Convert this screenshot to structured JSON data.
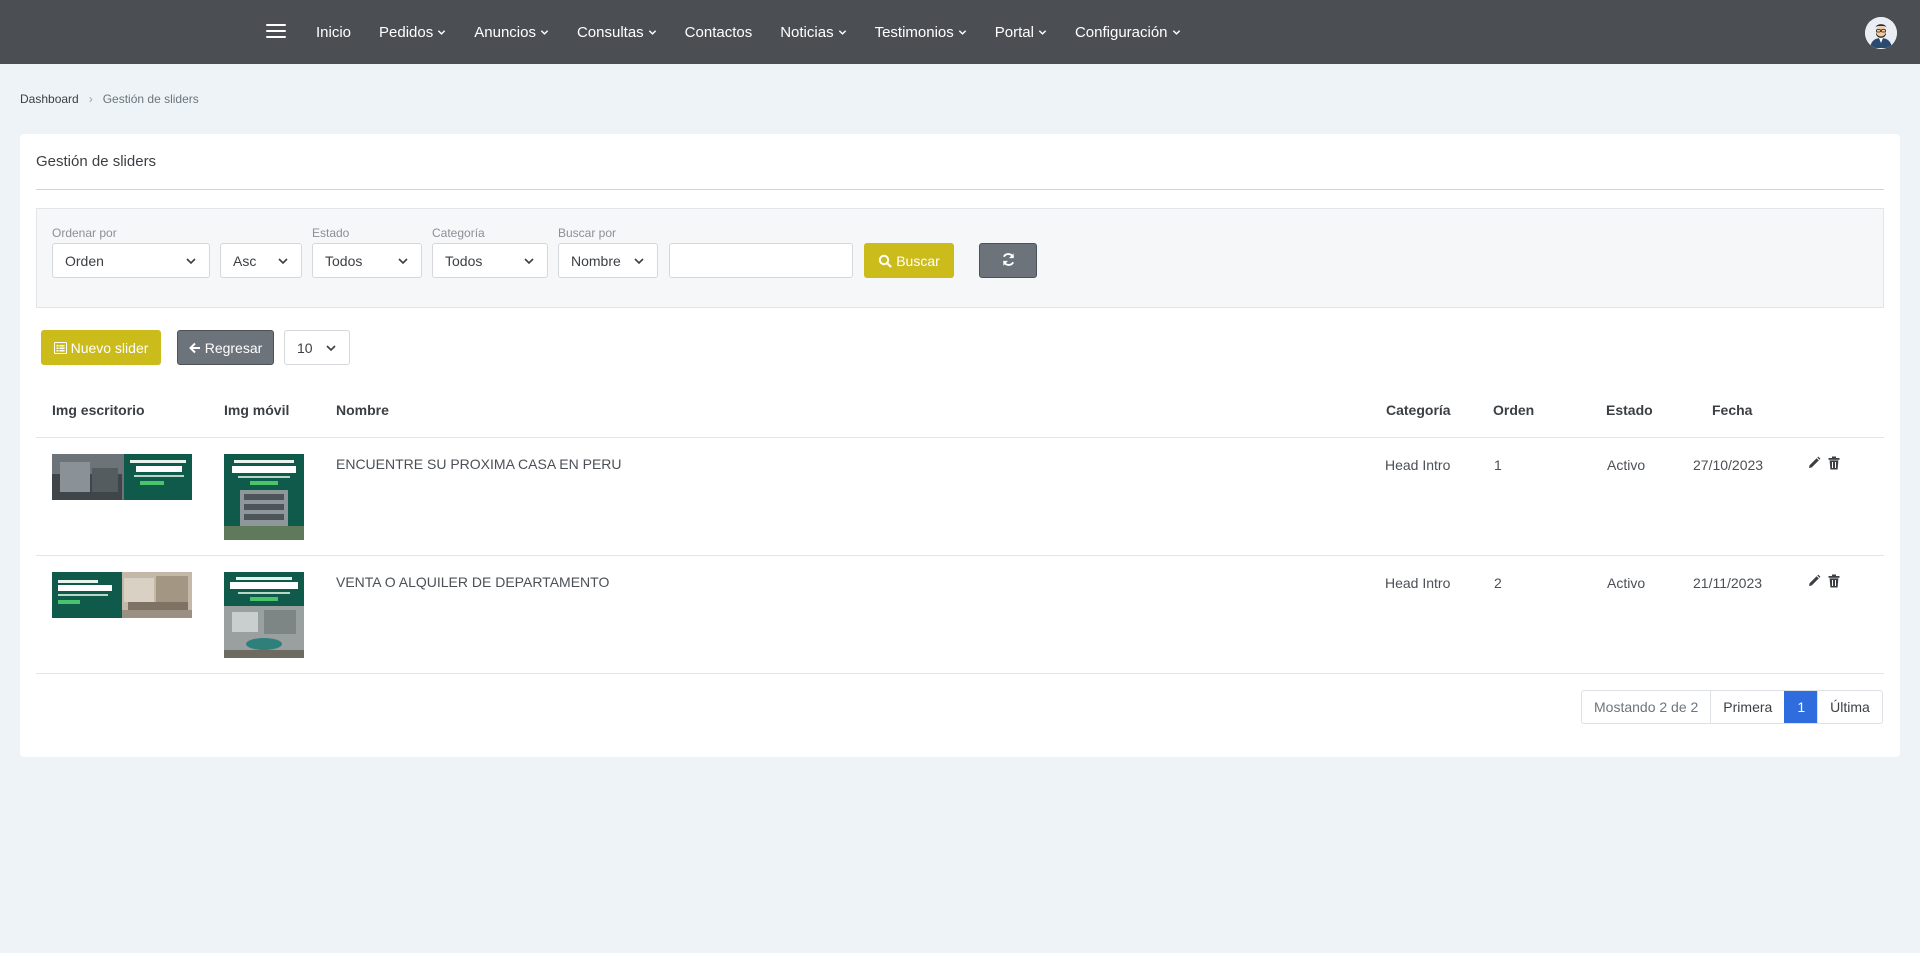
{
  "navbar": {
    "menu_icon": "hamburger-icon",
    "items": [
      {
        "label": "Inicio",
        "dropdown": false
      },
      {
        "label": "Pedidos",
        "dropdown": true
      },
      {
        "label": "Anuncios",
        "dropdown": true
      },
      {
        "label": "Consultas",
        "dropdown": true
      },
      {
        "label": "Contactos",
        "dropdown": false
      },
      {
        "label": "Noticias",
        "dropdown": true
      },
      {
        "label": "Testimonios",
        "dropdown": true
      },
      {
        "label": "Portal",
        "dropdown": true
      },
      {
        "label": "Configuración",
        "dropdown": true
      }
    ],
    "avatar_icon": "user-avatar-icon"
  },
  "breadcrumb": {
    "home": "Dashboard",
    "current": "Gestión de sliders"
  },
  "card": {
    "title": "Gestión de sliders"
  },
  "filters": {
    "order_by": {
      "label": "Ordenar por",
      "value": "Orden"
    },
    "direction": {
      "value": "Asc"
    },
    "status": {
      "label": "Estado",
      "value": "Todos"
    },
    "category": {
      "label": "Categoría",
      "value": "Todos"
    },
    "search_by": {
      "label": "Buscar por",
      "value": "Nombre"
    },
    "search": {
      "value": "",
      "placeholder": ""
    },
    "search_button": "Buscar",
    "refresh_icon": "refresh-icon"
  },
  "toolbar": {
    "new_button": "Nuevo slider",
    "back_button": "Regresar",
    "per_page": "10"
  },
  "table": {
    "headers": {
      "img_desktop": "Img escritorio",
      "img_mobile": "Img móvil",
      "name": "Nombre",
      "category": "Categoría",
      "order": "Orden",
      "status": "Estado",
      "date": "Fecha"
    },
    "rows": [
      {
        "name": "ENCUENTRE SU PROXIMA CASA EN PERU",
        "category": "Head Intro",
        "order": "1",
        "status": "Activo",
        "date": "27/10/2023",
        "thumb_desktop_text": "ENCUENTRE SU PRÓXIMA CASA EN PERÚ",
        "thumb_mobile_line1": "ENCUENTRE SU PRÓXIMA",
        "thumb_mobile_line2": "CASA EN PERÚ"
      },
      {
        "name": "VENTA O ALQUILER DE DEPARTAMENTO",
        "category": "Head Intro",
        "order": "2",
        "status": "Activo",
        "date": "21/11/2023",
        "thumb_desktop_text": "VENTA O ALQUILER DE DEPARTAMENTOS",
        "thumb_mobile_line1": "VENTA O ALQUILER DE",
        "thumb_mobile_line2": "DEPARTAMENTOS"
      }
    ]
  },
  "pagination": {
    "info": "Mostando 2 de 2",
    "first": "Primera",
    "current": "1",
    "last": "Última"
  },
  "colors": {
    "navbar": "#4b4f53",
    "accent_yellow": "#cbbb1b",
    "secondary_gray": "#6c737a",
    "active_page": "#2f6dde",
    "thumb_green": "#0f5a4a"
  }
}
